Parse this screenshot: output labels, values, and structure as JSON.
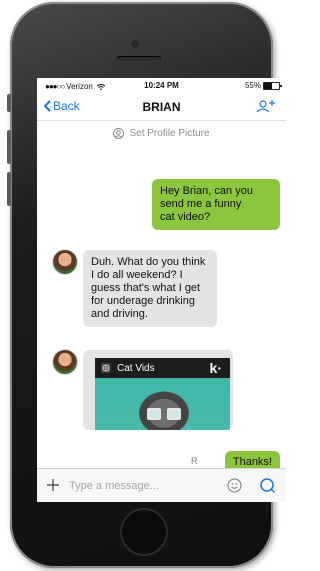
{
  "status_bar": {
    "signal": "●●●○○",
    "carrier": "Verizon",
    "time": "10:24 PM",
    "battery": "55%"
  },
  "nav": {
    "back_label": "Back",
    "title": "BRIAN"
  },
  "profile": {
    "set_picture_label": "Set Profile Picture"
  },
  "messages": [
    {
      "direction": "outgoing",
      "text": "Hey Brian, can you\nsend me a funny\ncat video?"
    },
    {
      "direction": "incoming",
      "text": "Duh. What do you think\nI do all weekend? I\nguess that's what I get\nfor underage drinking\nand driving."
    },
    {
      "direction": "incoming",
      "type": "card",
      "card_title": "Cat Vids",
      "card_logo": "k·"
    },
    {
      "direction": "outgoing",
      "text": "Thanks!"
    }
  ],
  "read_receipt": "R",
  "composer": {
    "placeholder": "Type a message..."
  },
  "colors": {
    "accent": "#1b74e4",
    "outgoing_bubble": "#8cc63f",
    "incoming_bubble": "#e4e4e6"
  },
  "icons": [
    "chevron-left-icon",
    "add-person-icon",
    "camera-icon",
    "globe-icon",
    "plus-icon",
    "emoji-icon",
    "search-icon",
    "wifi-icon",
    "battery-icon"
  ]
}
